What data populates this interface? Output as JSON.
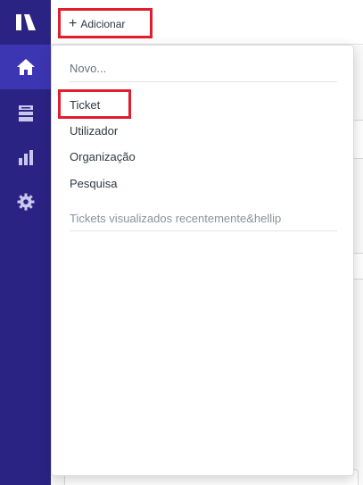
{
  "header": {
    "add_button_icon": "plus-icon",
    "add_button_label": "Adicionar"
  },
  "nav": {
    "items": [
      {
        "name": "logo",
        "icon": "zendesk-logo-icon"
      },
      {
        "name": "home",
        "icon": "home-icon",
        "active": true
      },
      {
        "name": "views",
        "icon": "views-icon"
      },
      {
        "name": "reports",
        "icon": "bar-chart-icon"
      },
      {
        "name": "settings",
        "icon": "gear-icon"
      }
    ]
  },
  "menu": {
    "header": "Novo...",
    "items": [
      {
        "label": "Ticket"
      },
      {
        "label": "Utilizador"
      },
      {
        "label": "Organização"
      },
      {
        "label": "Pesquisa"
      }
    ],
    "footer": "Tickets visualizados recentemente&hellip"
  },
  "colors": {
    "rail": "#2a2384",
    "rail_active": "#3d36b3",
    "highlight": "#e01e2c"
  }
}
